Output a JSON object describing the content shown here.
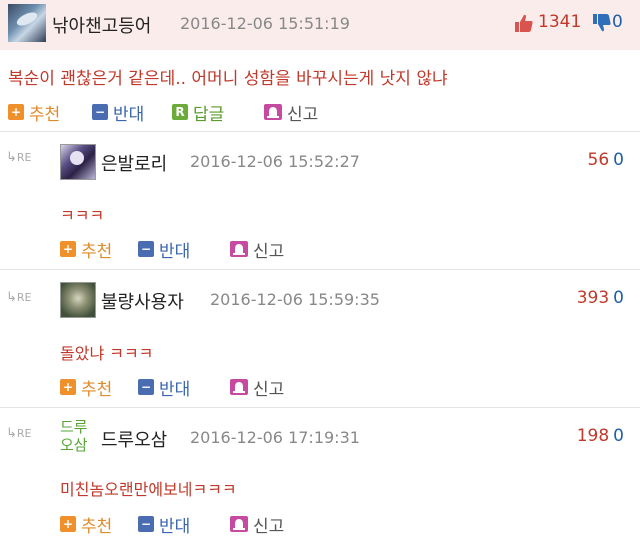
{
  "main_comment": {
    "nickname": "낚아챈고등어",
    "date": "2016-12-06 15:51:19",
    "up_count": "1341",
    "down_count": "0",
    "text": "복순이 괜찮은거 같은데.. 어머니 성함을 바꾸시는게 낫지 않냐",
    "actions": {
      "recommend": "추천",
      "oppose": "반대",
      "reply": "답글",
      "report": "신고"
    }
  },
  "badges": {
    "plus": "+",
    "minus": "−",
    "reply": "R"
  },
  "re_label": "RE",
  "replies": [
    {
      "nickname": "은발로리",
      "date": "2016-12-06 15:52:27",
      "up_count": "56",
      "down_count": "0",
      "text": "ㅋㅋㅋ",
      "actions": {
        "recommend": "추천",
        "oppose": "반대",
        "report": "신고"
      }
    },
    {
      "nickname": "불량사용자",
      "date": "2016-12-06 15:59:35",
      "up_count": "393",
      "down_count": "0",
      "text": "돌았냐 ㅋㅋㅋ",
      "actions": {
        "recommend": "추천",
        "oppose": "반대",
        "report": "신고"
      }
    },
    {
      "nickname": "드루오삼",
      "avatar_text": [
        "드루",
        "오삼"
      ],
      "date": "2016-12-06 17:19:31",
      "up_count": "198",
      "down_count": "0",
      "text": "미친놈오랜만에보네ㅋㅋㅋ",
      "actions": {
        "recommend": "추천",
        "oppose": "반대",
        "report": "신고"
      }
    }
  ],
  "colors": {
    "header_bg": "#fbecec",
    "up": "#c0392b",
    "down": "#1f5fa8",
    "recommend": "#e08b2a",
    "oppose": "#3a66b0",
    "reply": "#5b9b2f"
  },
  "icons": {
    "vote_up": "thumbs-up-icon",
    "vote_down": "thumbs-down-icon",
    "re": "reply-arrow-icon",
    "report": "siren-icon"
  }
}
